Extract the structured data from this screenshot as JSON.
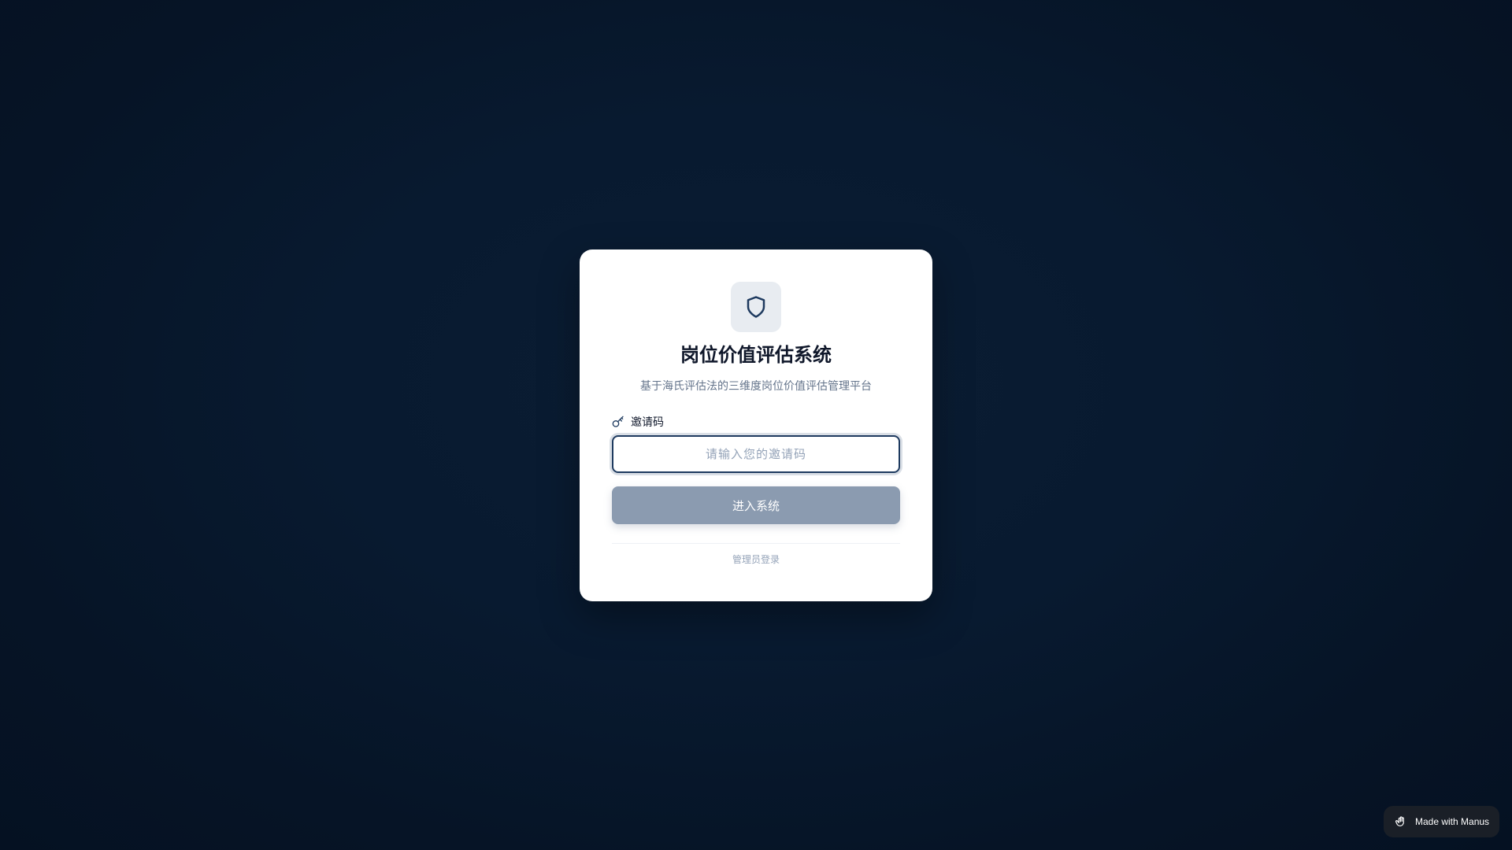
{
  "card": {
    "title": "岗位价值评估系统",
    "subtitle": "基于海氏评估法的三维度岗位价值评估管理平台",
    "logo_icon": "shield-icon",
    "invite_label": "邀请码",
    "invite_label_icon": "key-icon",
    "invite_input": {
      "value": "",
      "placeholder": "请输入您的邀请码"
    },
    "submit_label": "进入系统",
    "admin_link_label": "管理员登录"
  },
  "badge": {
    "label": "Made with Manus",
    "icon": "manus-hand-icon"
  },
  "colors": {
    "background": "#081a30",
    "card": "#ffffff",
    "accent": "#1e3a5f",
    "button_disabled": "#8b9bb0"
  }
}
